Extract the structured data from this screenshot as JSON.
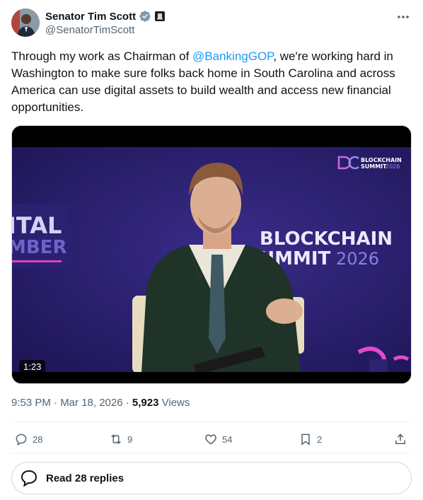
{
  "author": {
    "name": "Senator Tim Scott",
    "handle": "@SenatorTimScott"
  },
  "tweet": {
    "text_before": "Through my work as Chairman of ",
    "mention": "@BankingGOP",
    "text_after": ", we're working hard in Washington to make sure folks back home in South Carolina and across America can use digital assets to build wealth and access new financial opportunities."
  },
  "video": {
    "duration": "1:23",
    "backdrop_left_line1": "ITAL",
    "backdrop_left_line2": "MBER",
    "backdrop_main_line1": "BLOCKCHAIN",
    "backdrop_main_line2a": "UMMIT",
    "backdrop_main_line2b": "2026",
    "logo_line1": "BLOCKCHAIN",
    "logo_line2": "SUMMIT",
    "logo_year": "2026"
  },
  "meta": {
    "time_date": "9:53 PM · Mar 18, 2026 · ",
    "views_count": "5,923",
    "views_label": " Views"
  },
  "actions": {
    "replies": "28",
    "reposts": "9",
    "likes": "54",
    "bookmarks": "2"
  },
  "read_replies_label": "Read 28 replies",
  "colors": {
    "accent": "#1d9bf0",
    "text": "#0f1419",
    "muted": "#536471",
    "stage_purple": "#2a1e6e"
  }
}
